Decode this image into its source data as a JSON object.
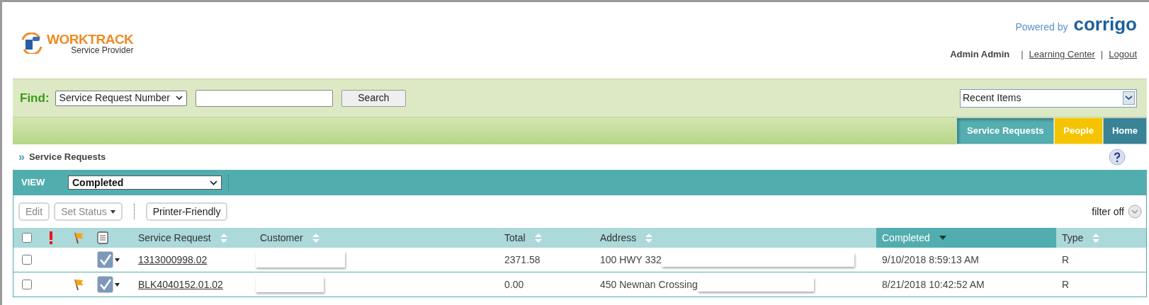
{
  "header": {
    "logo_title": "WORKTRACK",
    "logo_subtitle": "Service Provider",
    "powered_by": "Powered by",
    "brand": "corrigo",
    "user": "Admin Admin",
    "separators": [
      "|",
      "|"
    ],
    "links": [
      "Learning Center",
      "Logout"
    ]
  },
  "find": {
    "label": "Find:",
    "field_select": "Service Request Number",
    "button": "Search",
    "recent": "Recent Items"
  },
  "tabs": [
    {
      "label": "Service Requests",
      "selected": true,
      "color": "#55aeb0"
    },
    {
      "label": "People",
      "selected": false,
      "color": "#f5c400"
    },
    {
      "label": "Home",
      "selected": false,
      "color": "#3a8296"
    }
  ],
  "breadcrumb_marker": "»",
  "breadcrumb": "Service Requests",
  "view": {
    "label": "VIEW",
    "value": "Completed"
  },
  "toolbar": {
    "buttons": [
      {
        "label": "Edit",
        "disabled": true,
        "dropdown": false
      },
      {
        "label": "Set Status",
        "disabled": true,
        "dropdown": true
      },
      {
        "label": "Printer-Friendly",
        "disabled": false,
        "dropdown": false
      }
    ],
    "filter": "filter off"
  },
  "table": {
    "columns": [
      {
        "label": "Service Request",
        "sorted_descending": false,
        "selected": false
      },
      {
        "label": "Customer",
        "sorted_descending": false,
        "selected": false
      },
      {
        "label": "Total",
        "sorted_descending": false,
        "selected": false
      },
      {
        "label": "Address",
        "sorted_descending": false,
        "selected": false
      },
      {
        "label": "Completed",
        "sorted_descending": true,
        "selected": true
      },
      {
        "label": "Type",
        "sorted_descending": false,
        "selected": false
      }
    ],
    "all_checked": false,
    "rows": [
      {
        "checked": false,
        "urgent": false,
        "flagged": false,
        "number": "1313000998.02",
        "customer": "",
        "total": "2371.58",
        "address": "100 HWY 332",
        "completed": "9/10/2018 8:59:13 AM",
        "type": "R"
      },
      {
        "checked": false,
        "urgent": false,
        "flagged": true,
        "number": "BLK4040152.01.02",
        "customer": "",
        "total": "0.00",
        "address": "450 Newnan Crossing",
        "completed": "8/21/2018 10:42:52 AM",
        "type": "R"
      }
    ]
  }
}
